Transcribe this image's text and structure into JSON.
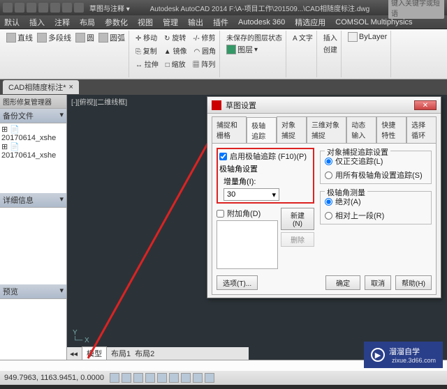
{
  "title": "Autodesk AutoCAD 2014  F:\\A-项目工作\\201509...\\CAD相随度标注.dwg",
  "search_placeholder": "键入关键字或短语",
  "menu": {
    "m0": "默认",
    "m1": "插入",
    "m2": "注释",
    "m3": "布局",
    "m4": "参数化",
    "m5": "视图",
    "m6": "管理",
    "m7": "输出",
    "m8": "插件",
    "m9": "Autodesk 360",
    "m10": "精选应用",
    "m11": "COMSOL Multiphysics"
  },
  "ribbon": {
    "line": "直线",
    "polyline": "多段线",
    "circle": "圆",
    "arc": "圆弧",
    "move": "✛ 移动",
    "rotate": "↻ 旋转",
    "trim": "-/- 修剪",
    "copy": "⎘ 复制",
    "mirror": "▲ 镜像",
    "fillet": "◠ 圆角",
    "stretch": "↔ 拉伸",
    "scale": "□ 缩放",
    "array": "▦ 阵列",
    "unsaved": "未保存的图层状态",
    "layer": "图层",
    "text": "A 文字",
    "insert": "插入",
    "create": "创建",
    "bylayer": "ByLayer"
  },
  "doctab": "CAD相随度标注*",
  "panels": {
    "repair": "图形修复管理器",
    "backup": "备份文件",
    "file1": "20170614_xshe",
    "file2": "20170614_xshe",
    "detail": "详细信息",
    "preview": "预览"
  },
  "viewport": "[-][俯视][二维线框]",
  "layout": {
    "model": "模型",
    "l1": "布局1",
    "l2": "布局2"
  },
  "status": {
    "coords": "949.7963, 1163.9451, 0.0000"
  },
  "dialog": {
    "title": "草图设置",
    "tabs": {
      "t0": "捕捉和栅格",
      "t1": "极轴追踪",
      "t2": "对象捕捉",
      "t3": "三维对象捕捉",
      "t4": "动态输入",
      "t5": "快捷特性",
      "t6": "选择循环"
    },
    "enable": "启用极轴追踪 (F10)(P)",
    "polar_group": "极轴角设置",
    "increment": "增量角(I):",
    "increment_val": "30",
    "additional": "附加角(D)",
    "new": "新建(N)",
    "delete": "删除",
    "obj_group": "对象捕捉追踪设置",
    "ortho": "仅正交追踪(L)",
    "allpolar": "用所有极轴角设置追踪(S)",
    "measure_group": "极轴角测量",
    "absolute": "绝对(A)",
    "relative": "相对上一段(R)",
    "options": "选项(T)...",
    "ok": "确定",
    "cancel": "取消",
    "help": "帮助(H)"
  },
  "watermark": {
    "brand": "溜溜自学",
    "url": "zixue.3d66.com"
  }
}
